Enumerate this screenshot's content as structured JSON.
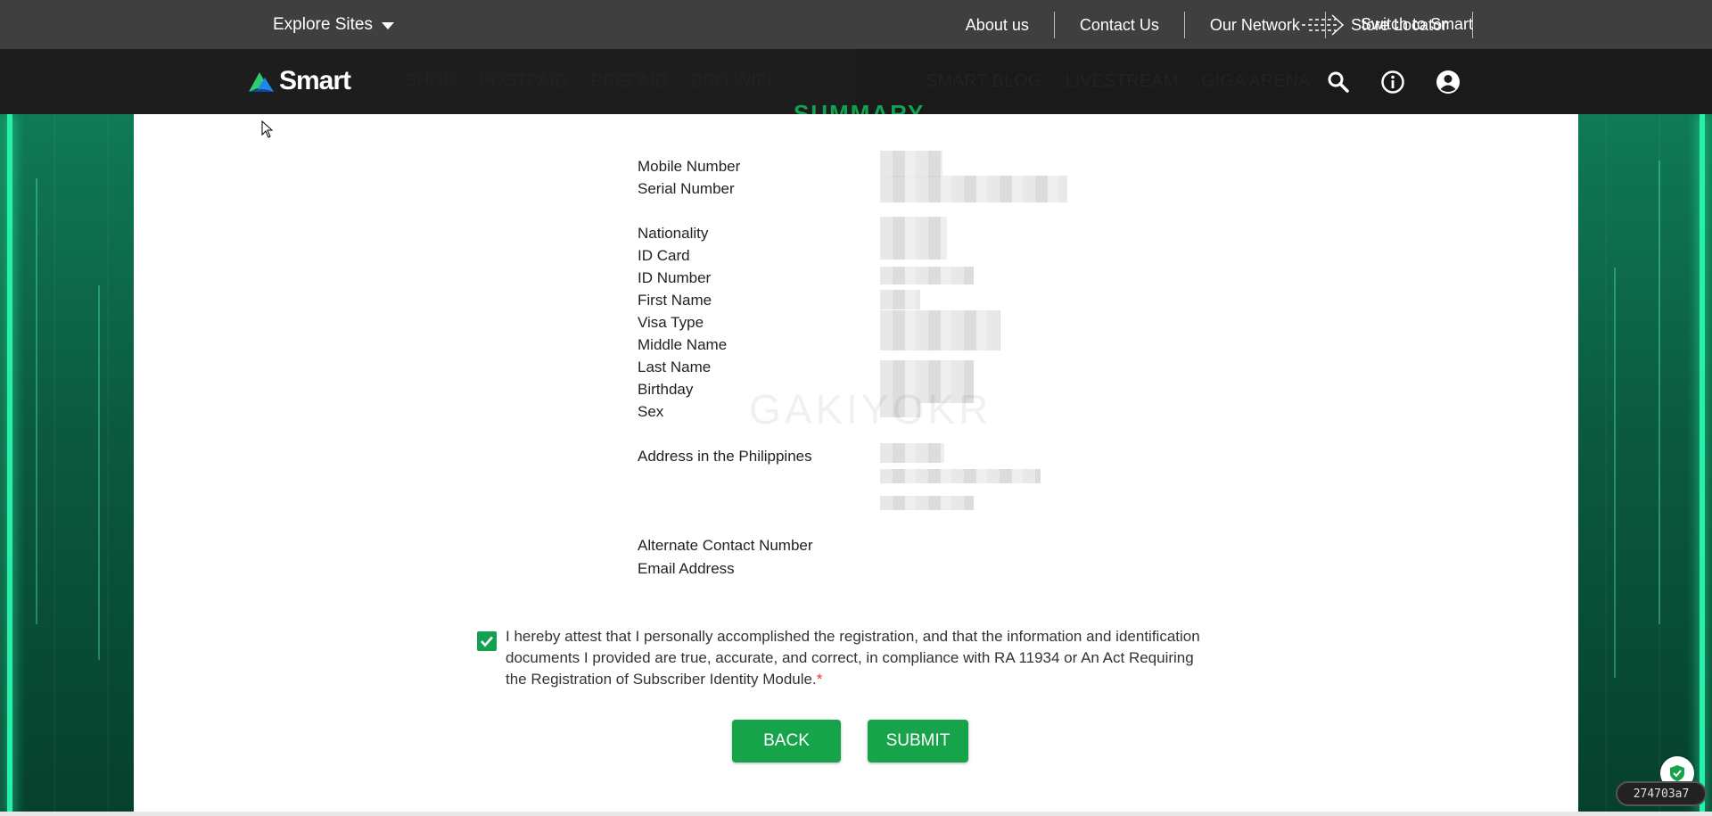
{
  "topbar": {
    "explore_label": "Explore Sites",
    "links": [
      "About us",
      "Contact Us",
      "Our Network",
      "Store Locator"
    ],
    "switch_label": "Switch to Smart"
  },
  "nav": {
    "logo_text": "Smart",
    "left_items": [
      "SHOP",
      "POSTPAID",
      "PREPAID",
      "BRO WIFI"
    ],
    "right_items": [
      "SMART BLOG",
      "LIVESTREAM",
      "GIGA ARENA"
    ],
    "icons": [
      "search-icon",
      "info-icon",
      "account-icon"
    ]
  },
  "summary": {
    "heading": "SUMMARY",
    "fields_group1": [
      "Mobile Number",
      "Serial Number"
    ],
    "fields_group2": [
      "Nationality",
      "ID Card",
      "ID Number",
      "First Name",
      "Visa Type",
      "Middle Name",
      "Last Name",
      "Birthday",
      "Sex"
    ],
    "fields_group3": [
      "Address in the Philippines"
    ],
    "fields_group4": [
      "Alternate Contact Number",
      "Email Address"
    ],
    "watermark": "GAKIYOKR"
  },
  "attestation": {
    "checked": true,
    "text": "I hereby attest that I personally accomplished the registration, and that the information and identification documents I provided are true, accurate, and correct, in compliance with RA 11934 or An Act Requiring the Registration of Subscriber Identity Module.",
    "required_mark": "*"
  },
  "buttons": {
    "back": "BACK",
    "submit": "SUBMIT"
  },
  "badge_text": "274703a7",
  "colors": {
    "brand_green": "#17a34a",
    "topbar": "#3f3f3f",
    "navbar": "#1d1d1d"
  }
}
